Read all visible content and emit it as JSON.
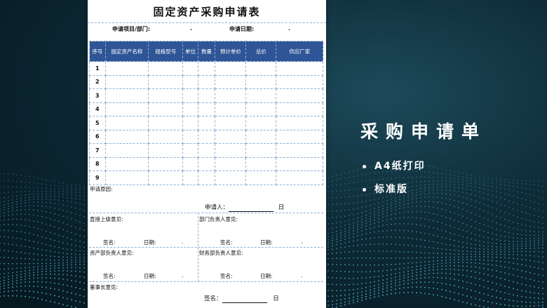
{
  "form": {
    "title": "固定资产采购申请表",
    "project_label": "申请项目/部门:",
    "project_dot": ".",
    "date_label": "申请日期:",
    "date_dot": ".",
    "columns": [
      "序号",
      "固定资产名称",
      "规格型号",
      "单位",
      "数量",
      "预计单价",
      "总价",
      "供应厂家"
    ],
    "rows": [
      "1",
      "2",
      "3",
      "4",
      "5",
      "6",
      "7",
      "8",
      "9"
    ],
    "reason_label": "申请原因:",
    "applicant_label": "申请人：",
    "applicant_day": "日",
    "supervisor_label": "直接上级意见:",
    "dept_head_label": "部门负责人意见:",
    "sign_label": "签名:",
    "date_short": "日期:",
    "dot": ".",
    "asset_dept_label": "资产部负责人意见:",
    "finance_dept_label": "财务部负责人意见:",
    "chairman_label": "董事长意见:",
    "final_sign_label": "签名：",
    "final_day": "日"
  },
  "side": {
    "heading": "采购申请单",
    "bullets": [
      "A4纸打印",
      "标准版"
    ]
  },
  "colors": {
    "header_blue": "#2f5597",
    "bg_dark": "#061820",
    "dots": "#5fd0e8"
  }
}
